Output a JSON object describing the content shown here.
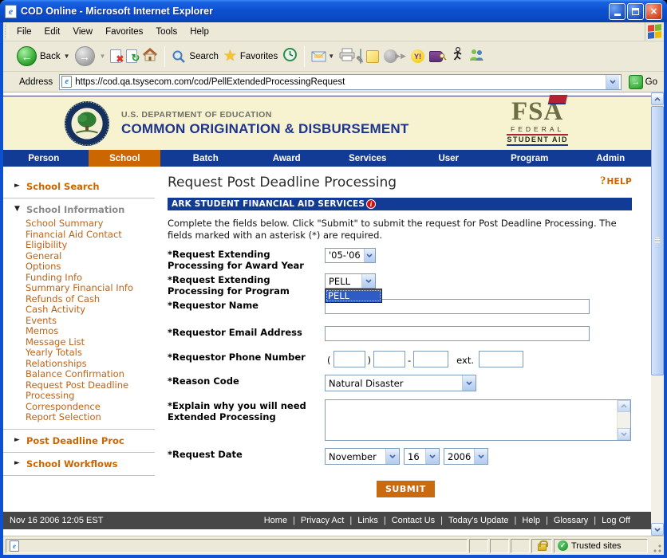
{
  "window": {
    "title": "COD Online - Microsoft Internet Explorer"
  },
  "menu": {
    "items": [
      "File",
      "Edit",
      "View",
      "Favorites",
      "Tools",
      "Help"
    ]
  },
  "toolbar": {
    "back": "Back",
    "search": "Search",
    "favorites": "Favorites"
  },
  "address": {
    "label": "Address",
    "url": "https://cod.qa.tsysecom.com/cod/PellExtendedProcessingRequest",
    "go": "Go"
  },
  "banner": {
    "agency": "U.S. DEPARTMENT OF EDUCATION",
    "title": "COMMON ORIGINATION & DISBURSEMENT",
    "fsa_acronym": "FSA",
    "fsa_line1": "FEDERAL",
    "fsa_line2": "STUDENT AID"
  },
  "nav": {
    "tabs": [
      {
        "label": "Person",
        "active": false
      },
      {
        "label": "School",
        "active": true
      },
      {
        "label": "Batch",
        "active": false
      },
      {
        "label": "Award",
        "active": false
      },
      {
        "label": "Services",
        "active": false
      },
      {
        "label": "User",
        "active": false
      },
      {
        "label": "Program",
        "active": false
      },
      {
        "label": "Admin",
        "active": false
      }
    ]
  },
  "sidebar": {
    "school_search": "School Search",
    "school_information": "School Information",
    "links": [
      "School Summary",
      "Financial Aid Contact",
      "Eligibility",
      "General",
      "Options",
      "Funding Info",
      "Summary Financial Info",
      "Refunds of Cash",
      "Cash Activity",
      "Events",
      "Memos",
      "Message List",
      "Yearly Totals",
      "Relationships",
      "Balance Confirmation",
      "Request Post Deadline Processing",
      "Correspondence",
      "Report Selection"
    ],
    "post_deadline": "Post Deadline Proc",
    "school_workflows": "School Workflows"
  },
  "main": {
    "page_title": "Request Post Deadline Processing",
    "help": {
      "icon": "?",
      "label": "HELP"
    },
    "school_bar": {
      "text": "ARK STUDENT FINANCIAL AID SERVICES",
      "info_icon": "i"
    },
    "instructions": "Complete the fields below. Click \"Submit\" to submit the request for Post Deadline Processing. The fields marked with an asterisk (*) are required.",
    "form": {
      "award_year_label": "*Request Extending Processing for Award Year",
      "award_year_value": "'05-'06",
      "program_label": "*Request Extending Processing for Program",
      "program_value": "PELL",
      "program_open_option": "PELL",
      "requestor_name_label": "*Requestor Name",
      "requestor_name_value": "",
      "email_label": "*Requestor Email Address",
      "email_value": "",
      "phone_label": "*Requestor Phone Number",
      "phone_values": [
        "",
        "",
        "",
        ""
      ],
      "phone_open_paren": "(",
      "phone_close_paren": ")",
      "phone_dash": "-",
      "phone_ext_label": "ext.",
      "reason_label": "*Reason Code",
      "reason_value": "Natural Disaster",
      "explain_label": "*Explain why you will need Extended Processing",
      "explain_value": "",
      "date_label": "*Request Date",
      "date_month": "November",
      "date_day": "16",
      "date_year": "2006",
      "submit": "SUBMIT"
    }
  },
  "footer": {
    "timestamp": "Nov 16 2006 12:05 EST",
    "separator": "|",
    "links": [
      "Home",
      "Privacy Act",
      "Links",
      "Contact Us",
      "Today's Update",
      "Help",
      "Glossary",
      "Log Off"
    ]
  },
  "status": {
    "trusted": "Trusted sites"
  },
  "colors": {
    "nav_blue": "#123B96",
    "accent_orange": "#CC6600",
    "banner_bg": "#F7F3D0",
    "footer_gray": "#474747",
    "link_orange": "#BF6215",
    "xp_border": "#7F9DB9",
    "selection_blue": "#2E5BC4"
  }
}
